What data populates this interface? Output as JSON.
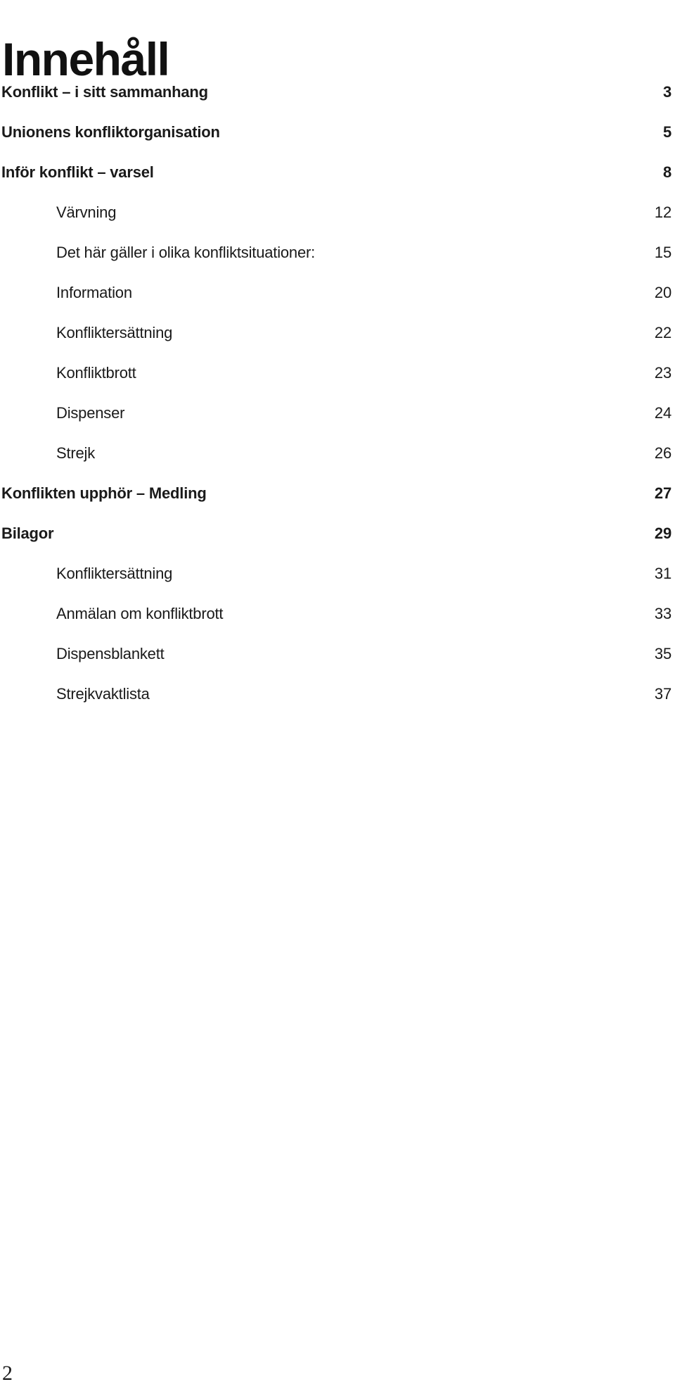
{
  "document": {
    "title": "Innehåll",
    "footer_page_number": "2",
    "text_color": "#1a1a1a",
    "background_color": "#ffffff"
  },
  "toc": {
    "entries": [
      {
        "label": "Konflikt – i sitt sammanhang",
        "page": "3",
        "level": 1
      },
      {
        "label": "Unionens konfliktorganisation",
        "page": "5",
        "level": 1
      },
      {
        "label": "Inför konflikt – varsel",
        "page": "8",
        "level": 1
      },
      {
        "label": "Värvning",
        "page": "12",
        "level": 2
      },
      {
        "label": "Det här gäller i olika konfliktsituationer:",
        "page": "15",
        "level": 2
      },
      {
        "label": "Information",
        "page": "20",
        "level": 2
      },
      {
        "label": "Konfliktersättning",
        "page": "22",
        "level": 2
      },
      {
        "label": "Konfliktbrott",
        "page": "23",
        "level": 2
      },
      {
        "label": "Dispenser",
        "page": "24",
        "level": 2
      },
      {
        "label": "Strejk",
        "page": "26",
        "level": 2
      },
      {
        "label": "Konflikten upphör – Medling",
        "page": "27",
        "level": 1
      },
      {
        "label": "Bilagor",
        "page": "29",
        "level": 1
      },
      {
        "label": "Konfliktersättning",
        "page": "31",
        "level": 2
      },
      {
        "label": "Anmälan om konfliktbrott",
        "page": "33",
        "level": 2
      },
      {
        "label": "Dispensblankett",
        "page": "35",
        "level": 2
      },
      {
        "label": "Strejkvaktlista",
        "page": "37",
        "level": 2
      }
    ]
  }
}
